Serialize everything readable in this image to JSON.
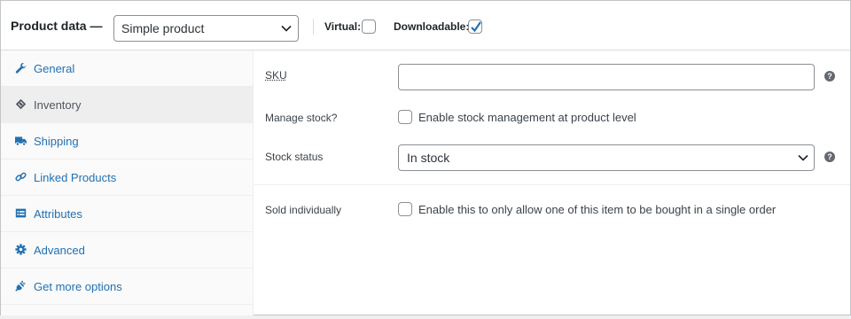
{
  "header": {
    "title": "Product data —",
    "product_type": "Simple product",
    "virtual_label": "Virtual:",
    "virtual_checked": false,
    "downloadable_label": "Downloadable:",
    "downloadable_checked": true
  },
  "sidebar": {
    "active_tab": "Inventory",
    "items": [
      {
        "label": "General",
        "icon": "wrench-icon"
      },
      {
        "label": "Inventory",
        "icon": "tag-icon"
      },
      {
        "label": "Shipping",
        "icon": "truck-icon"
      },
      {
        "label": "Linked Products",
        "icon": "link-icon"
      },
      {
        "label": "Attributes",
        "icon": "list-table-icon"
      },
      {
        "label": "Advanced",
        "icon": "gear-icon"
      },
      {
        "label": "Get more options",
        "icon": "plug-icon"
      }
    ]
  },
  "inventory": {
    "sku_label": "SKU",
    "sku_value": "",
    "manage_stock_label": "Manage stock?",
    "manage_stock_text": "Enable stock management at product level",
    "manage_stock_checked": false,
    "stock_status_label": "Stock status",
    "stock_status_value": "In stock",
    "sold_individually_label": "Sold individually",
    "sold_individually_text": "Enable this to only allow one of this item to be bought in a single order",
    "sold_individually_checked": false,
    "help_glyph": "?"
  },
  "colors": {
    "link": "#2271b1",
    "check": "#2271b1",
    "border": "#8c8f94"
  }
}
